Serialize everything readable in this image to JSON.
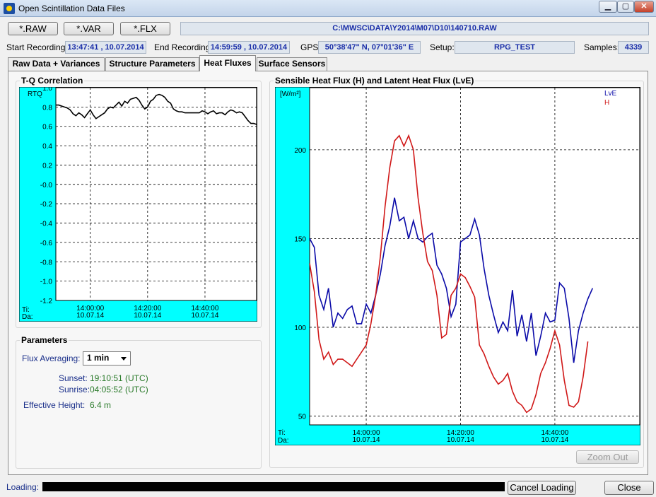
{
  "window": {
    "title": "Open Scintillation Data Files",
    "min_glyph": "▁",
    "max_glyph": "▢",
    "close_glyph": "✕"
  },
  "file_buttons": [
    "*.RAW",
    "*.VAR",
    "*.FLX"
  ],
  "file_path": "C:\\MWSC\\DATA\\Y2014\\M07\\D10\\140710.RAW",
  "info": {
    "start_label": "Start Recording:",
    "start_value": "13:47:41 , 10.07.2014",
    "end_label": "End Recording:",
    "end_value": "14:59:59 , 10.07.2014",
    "gps_label": "GPS:",
    "gps_value": "50°38'47\" N, 07°01'36\" E",
    "setup_label": "Setup:",
    "setup_value": "RPG_TEST",
    "samples_label": "Samples:",
    "samples_value": "4339"
  },
  "tabs": [
    "Raw Data + Variances",
    "Structure Parameters",
    "Heat Fluxes",
    "Surface Sensors"
  ],
  "active_tab": 2,
  "tq_panel": {
    "title": "T-Q Correlation"
  },
  "params": {
    "title": "Parameters",
    "flux_label": "Flux Averaging:",
    "flux_value": "1 min",
    "sunset_label": "Sunset:",
    "sunset_value": "19:10:51 (UTC)",
    "sunrise_label": "Sunrise:",
    "sunrise_value": "04:05:52 (UTC)",
    "height_label": "Effective Height:",
    "height_value": "6.4 m"
  },
  "flux_panel": {
    "title": "Sensible Heat Flux (H) and Latent Heat Flux (LvE)"
  },
  "zoom_out": "Zoom Out",
  "bottom": {
    "loading_label": "Loading:",
    "cancel_label": "Cancel Loading",
    "close_label": "Close"
  },
  "colors": {
    "axis_bg": "#00ffff",
    "lve": "#0a0aa8",
    "h": "#d01818"
  },
  "chart_data": [
    {
      "type": "line",
      "ylabel": "RTQ",
      "ylim": [
        -1.2,
        1.0
      ],
      "yticks": [
        "1.0",
        "0.8",
        "0.6",
        "0.4",
        "0.2",
        "-0.0",
        "-0.2",
        "-0.4",
        "-0.6",
        "-0.8",
        "-1.0",
        "-1.2"
      ],
      "ytick_values": [
        1.0,
        0.8,
        0.6,
        0.4,
        0.2,
        0.0,
        -0.2,
        -0.4,
        -0.6,
        -0.8,
        -1.0,
        -1.2
      ],
      "xlim": [
        "13:48",
        "14:59"
      ],
      "xticks": [
        {
          "time": "14:00:00",
          "date": "10.07.14"
        },
        {
          "time": "14:20:00",
          "date": "10.07.14"
        },
        {
          "time": "14:40:00",
          "date": "10.07.14"
        }
      ],
      "xtick_minutes": [
        12,
        32,
        52
      ],
      "x_row_labels": [
        "Ti:",
        "Da:"
      ],
      "series": [
        {
          "color": "#000000",
          "x_minutes": [
            0,
            1,
            2,
            3,
            4,
            5,
            6,
            7,
            8,
            9,
            10,
            11,
            12,
            13,
            14,
            15,
            16,
            17,
            18,
            19,
            20,
            21,
            22,
            23,
            24,
            25,
            26,
            27,
            28,
            29,
            30,
            31,
            32,
            33,
            34,
            35,
            36,
            37,
            38,
            39,
            40,
            41,
            42,
            43,
            44,
            45,
            46,
            47,
            48,
            49,
            50,
            51,
            52,
            53,
            54,
            55,
            56,
            57,
            58,
            59,
            60,
            61,
            62,
            63,
            64,
            65,
            66,
            67,
            68,
            69,
            70
          ],
          "values": [
            0.82,
            0.82,
            0.81,
            0.8,
            0.79,
            0.77,
            0.73,
            0.71,
            0.74,
            0.72,
            0.69,
            0.73,
            0.77,
            0.72,
            0.68,
            0.7,
            0.72,
            0.74,
            0.78,
            0.8,
            0.79,
            0.82,
            0.85,
            0.81,
            0.86,
            0.84,
            0.88,
            0.89,
            0.9,
            0.87,
            0.82,
            0.78,
            0.8,
            0.86,
            0.88,
            0.92,
            0.93,
            0.92,
            0.9,
            0.86,
            0.84,
            0.78,
            0.76,
            0.75,
            0.75,
            0.74,
            0.74,
            0.74,
            0.74,
            0.74,
            0.74,
            0.76,
            0.75,
            0.73,
            0.75,
            0.76,
            0.73,
            0.74,
            0.74,
            0.72,
            0.75,
            0.77,
            0.76,
            0.74,
            0.75,
            0.74,
            0.7,
            0.66,
            0.63,
            0.63,
            0.62
          ]
        }
      ]
    },
    {
      "type": "line",
      "ylabel": "[W/m²]",
      "ylim": [
        45,
        235
      ],
      "yticks": [
        "200",
        "150",
        "100",
        "50"
      ],
      "ytick_values": [
        200,
        150,
        100,
        50
      ],
      "xlim": [
        "13:48",
        "14:59"
      ],
      "xticks": [
        {
          "time": "14:00:00",
          "date": "10.07.14"
        },
        {
          "time": "14:20:00",
          "date": "10.07.14"
        },
        {
          "time": "14:40:00",
          "date": "10.07.14"
        }
      ],
      "xtick_minutes": [
        12,
        32,
        52
      ],
      "x_row_labels": [
        "Ti:",
        "Da:"
      ],
      "legend": "top-right",
      "series": [
        {
          "name": "LvE",
          "color": "#0a0aa8",
          "x_minutes": [
            0,
            1,
            2,
            3,
            4,
            5,
            6,
            7,
            8,
            9,
            10,
            11,
            12,
            13,
            14,
            15,
            16,
            17,
            18,
            19,
            20,
            21,
            22,
            23,
            24,
            25,
            26,
            27,
            28,
            29,
            30,
            31,
            32,
            33,
            34,
            35,
            36,
            37,
            38,
            39,
            40,
            41,
            42,
            43,
            44,
            45,
            46,
            47,
            48,
            49,
            50,
            51,
            52,
            53,
            54,
            55,
            56,
            57,
            58,
            59,
            60,
            61,
            62,
            63,
            64,
            65,
            66,
            67,
            68,
            69,
            70
          ],
          "values": [
            150,
            145,
            118,
            110,
            122,
            100,
            108,
            105,
            110,
            112,
            102,
            102,
            113,
            108,
            118,
            130,
            146,
            157,
            173,
            160,
            162,
            150,
            160,
            150,
            148,
            151,
            153,
            135,
            130,
            122,
            106,
            113,
            148,
            150,
            152,
            161,
            152,
            133,
            118,
            107,
            97,
            103,
            98,
            121,
            95,
            107,
            92,
            108,
            84,
            95,
            108,
            103,
            104,
            125,
            122,
            105,
            80,
            98,
            108,
            116,
            122
          ]
        },
        {
          "name": "H",
          "color": "#d01818",
          "x_minutes": [
            0,
            1,
            2,
            3,
            4,
            5,
            6,
            7,
            8,
            9,
            10,
            11,
            12,
            13,
            14,
            15,
            16,
            17,
            18,
            19,
            20,
            21,
            22,
            23,
            24,
            25,
            26,
            27,
            28,
            29,
            30,
            31,
            32,
            33,
            34,
            35,
            36,
            37,
            38,
            39,
            40,
            41,
            42,
            43,
            44,
            45,
            46,
            47,
            48,
            49,
            50,
            51,
            52,
            53,
            54,
            55,
            56,
            57,
            58,
            59,
            60,
            61,
            62,
            63,
            64,
            65,
            66,
            67,
            68,
            69,
            70
          ],
          "values": [
            136,
            120,
            93,
            82,
            86,
            79,
            82,
            82,
            80,
            78,
            82,
            86,
            90,
            102,
            118,
            140,
            168,
            190,
            205,
            208,
            202,
            208,
            200,
            173,
            153,
            137,
            132,
            118,
            94,
            96,
            118,
            122,
            130,
            128,
            123,
            117,
            90,
            85,
            78,
            72,
            68,
            70,
            74,
            64,
            58,
            56,
            52,
            54,
            62,
            74,
            80,
            88,
            98,
            90,
            70,
            56,
            55,
            58,
            72,
            92
          ]
        }
      ]
    }
  ]
}
